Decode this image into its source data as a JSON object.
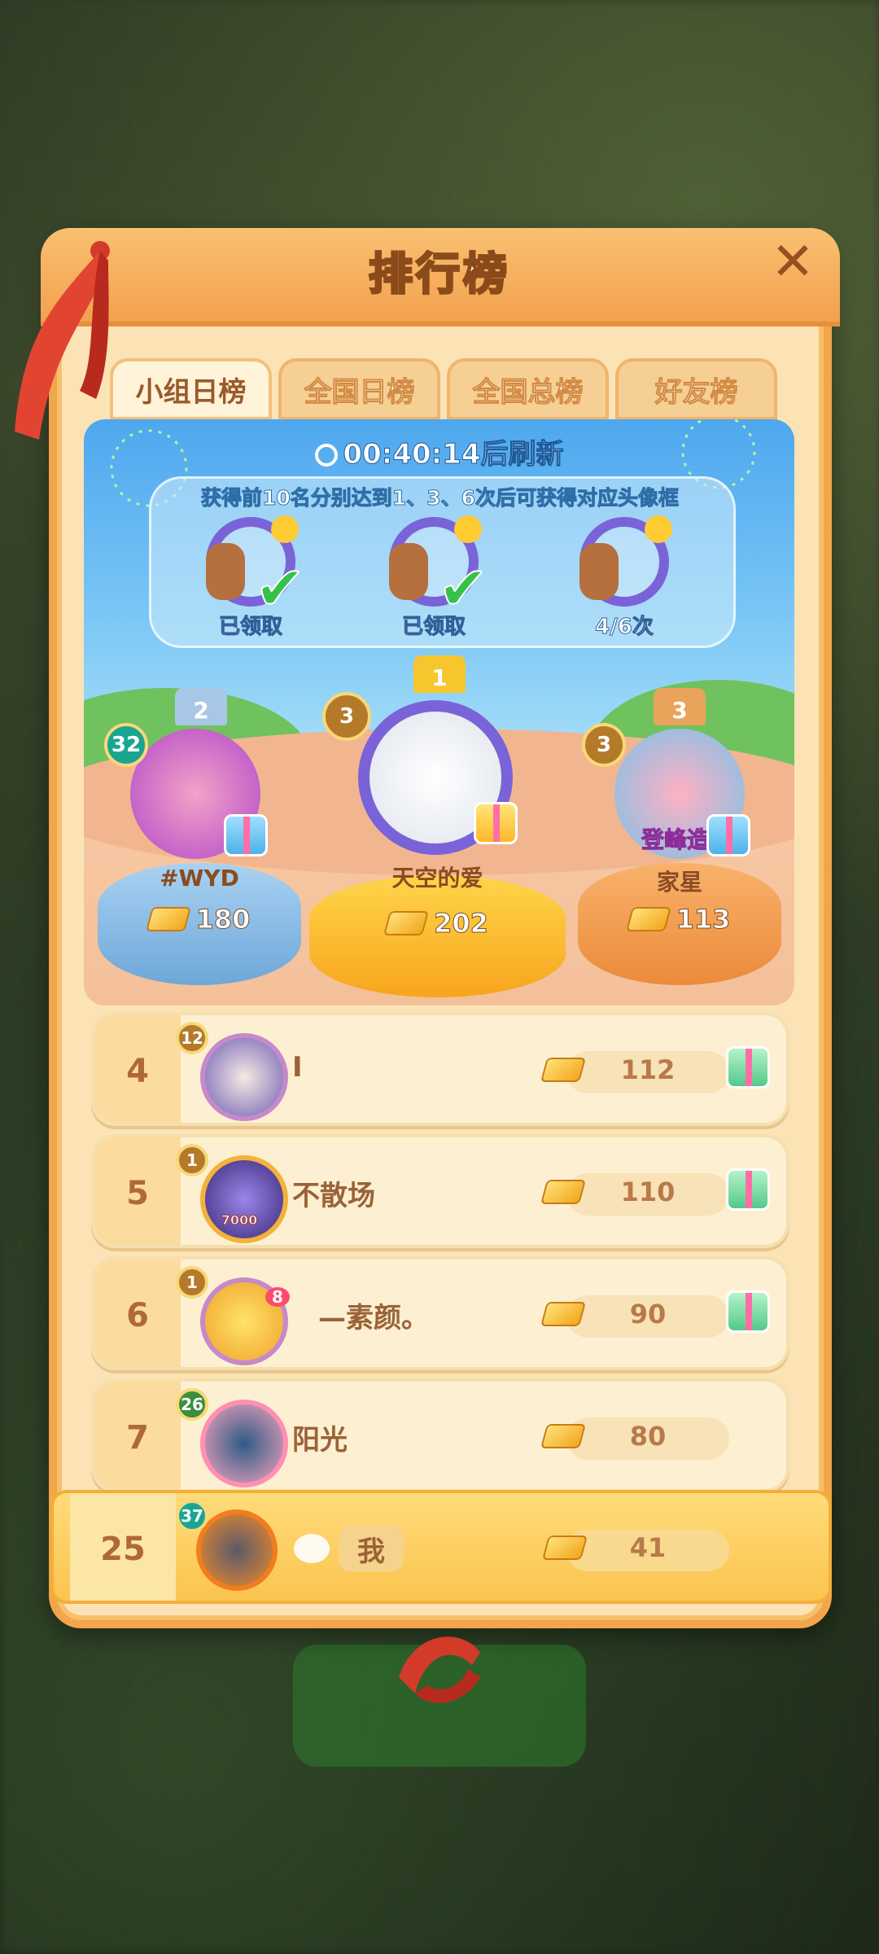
{
  "header": {
    "title": "排行榜",
    "close_label": "✕"
  },
  "tabs": [
    {
      "label": "小组日榜",
      "active": true
    },
    {
      "label": "全国日榜",
      "active": false
    },
    {
      "label": "全国总榜",
      "active": false
    },
    {
      "label": "好友榜",
      "active": false
    }
  ],
  "timer": {
    "text": "00:40:14后刷新"
  },
  "frames": {
    "description": "获得前10名分别达到1、3、6次后可获得对应头像框",
    "items": [
      {
        "label": "已领取",
        "claimed": true
      },
      {
        "label": "已领取",
        "claimed": true
      },
      {
        "label": "4/6次",
        "claimed": false
      }
    ]
  },
  "podium": [
    {
      "place": "2",
      "name": "#WYD",
      "score": "180",
      "level": "32"
    },
    {
      "place": "1",
      "name": "天空的爱",
      "score": "202",
      "level": "3"
    },
    {
      "place": "3",
      "name": "家星",
      "score": "113",
      "level": "3",
      "avatar_text": "登峰造"
    }
  ],
  "ranking": [
    {
      "rank": "4",
      "name": "I",
      "score": "112",
      "level": "12",
      "gift": true
    },
    {
      "rank": "5",
      "name": "不散场",
      "score": "110",
      "level": "1",
      "gift": true,
      "avatar_text": "7000"
    },
    {
      "rank": "6",
      "name": "—素颜。",
      "score": "90",
      "level": "1",
      "gift": true,
      "avatar_text": "8"
    },
    {
      "rank": "7",
      "name": "阳光",
      "score": "80",
      "level": "26",
      "gift": false
    }
  ],
  "me": {
    "rank": "25",
    "name": "我",
    "score": "41",
    "level": "37"
  },
  "colors": {
    "accent": "#f2a54a",
    "panel": "#fbe3b6",
    "gold": "#f2a51b",
    "check": "#36c24a"
  }
}
